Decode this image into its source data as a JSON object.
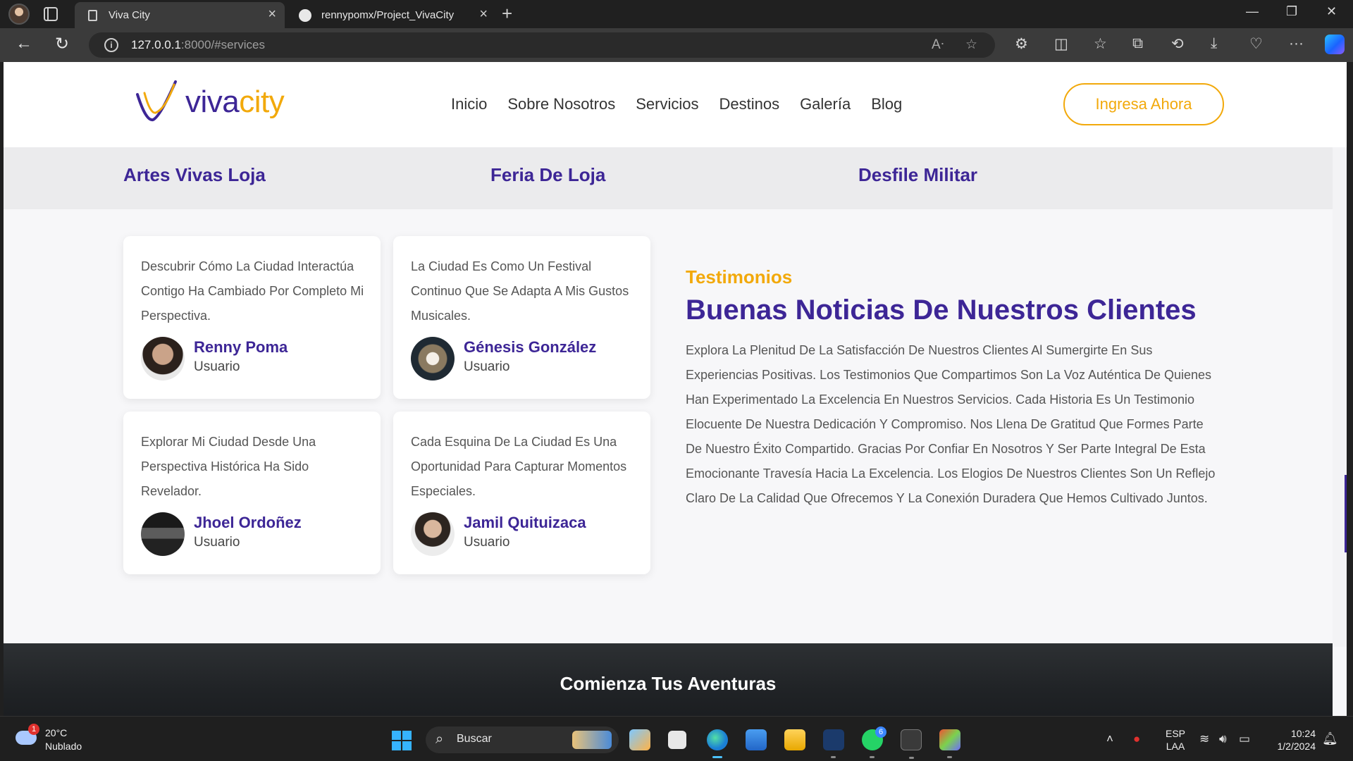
{
  "browser": {
    "tabs": [
      {
        "title": "Viva City",
        "active": true
      },
      {
        "title": "rennypomx/Project_VivaCity",
        "active": false
      }
    ],
    "address": {
      "host": "127.0.0.1",
      "rest": ":8000/#services"
    }
  },
  "site": {
    "logo": {
      "part1": "viva",
      "part2": "city"
    },
    "nav": [
      "Inicio",
      "Sobre Nosotros",
      "Servicios",
      "Destinos",
      "Galería",
      "Blog"
    ],
    "cta": "Ingresa Ahora",
    "events": [
      "Artes Vivas Loja",
      "Feria De Loja",
      "Desfile Militar"
    ],
    "testimonials": [
      {
        "quote": "Descubrir Cómo La Ciudad Interactúa Contigo Ha Cambiado Por Completo Mi Perspectiva.",
        "name": "Renny Poma",
        "role": "Usuario"
      },
      {
        "quote": "La Ciudad Es Como Un Festival Continuo Que Se Adapta A Mis Gustos Musicales.",
        "name": "Génesis González",
        "role": "Usuario"
      },
      {
        "quote": "Explorar Mi Ciudad Desde Una Perspectiva Histórica Ha Sido Revelador.",
        "name": "Jhoel Ordoñez",
        "role": "Usuario"
      },
      {
        "quote": "Cada Esquina De La Ciudad Es Una Oportunidad Para Capturar Momentos Especiales.",
        "name": "Jamil Quituizaca",
        "role": "Usuario"
      }
    ],
    "section": {
      "label": "Testimonios",
      "heading": "Buenas Noticias De Nuestros Clientes",
      "body": "Explora La Plenitud De La Satisfacción De Nuestros Clientes Al Sumergirte En Sus Experiencias Positivas. Los Testimonios Que Compartimos Son La Voz Auténtica De Quienes Han Experimentado La Excelencia En Nuestros Servicios. Cada Historia Es Un Testimonio Elocuente De Nuestra Dedicación Y Compromiso. Nos Llena De Gratitud Que Formes Parte De Nuestro Éxito Compartido. Gracias Por Confiar En Nosotros Y Ser Parte Integral De Esta Emocionante Travesía Hacia La Excelencia. Los Elogios De Nuestros Clientes Son Un Reflejo Claro De La Calidad Que Ofrecemos Y La Conexión Duradera Que Hemos Cultivado Juntos."
    },
    "banner": "Comienza Tus Aventuras",
    "colors": {
      "primary": "#3d2696",
      "accent": "#f2a90b"
    }
  },
  "taskbar": {
    "weather": {
      "temp": "20°C",
      "condition": "Nublado",
      "badge": "1"
    },
    "search": "Buscar",
    "whatsapp_badge": "6",
    "lang": {
      "line1": "ESP",
      "line2": "LAA"
    },
    "clock": {
      "time": "10:24",
      "date": "1/2/2024"
    }
  }
}
